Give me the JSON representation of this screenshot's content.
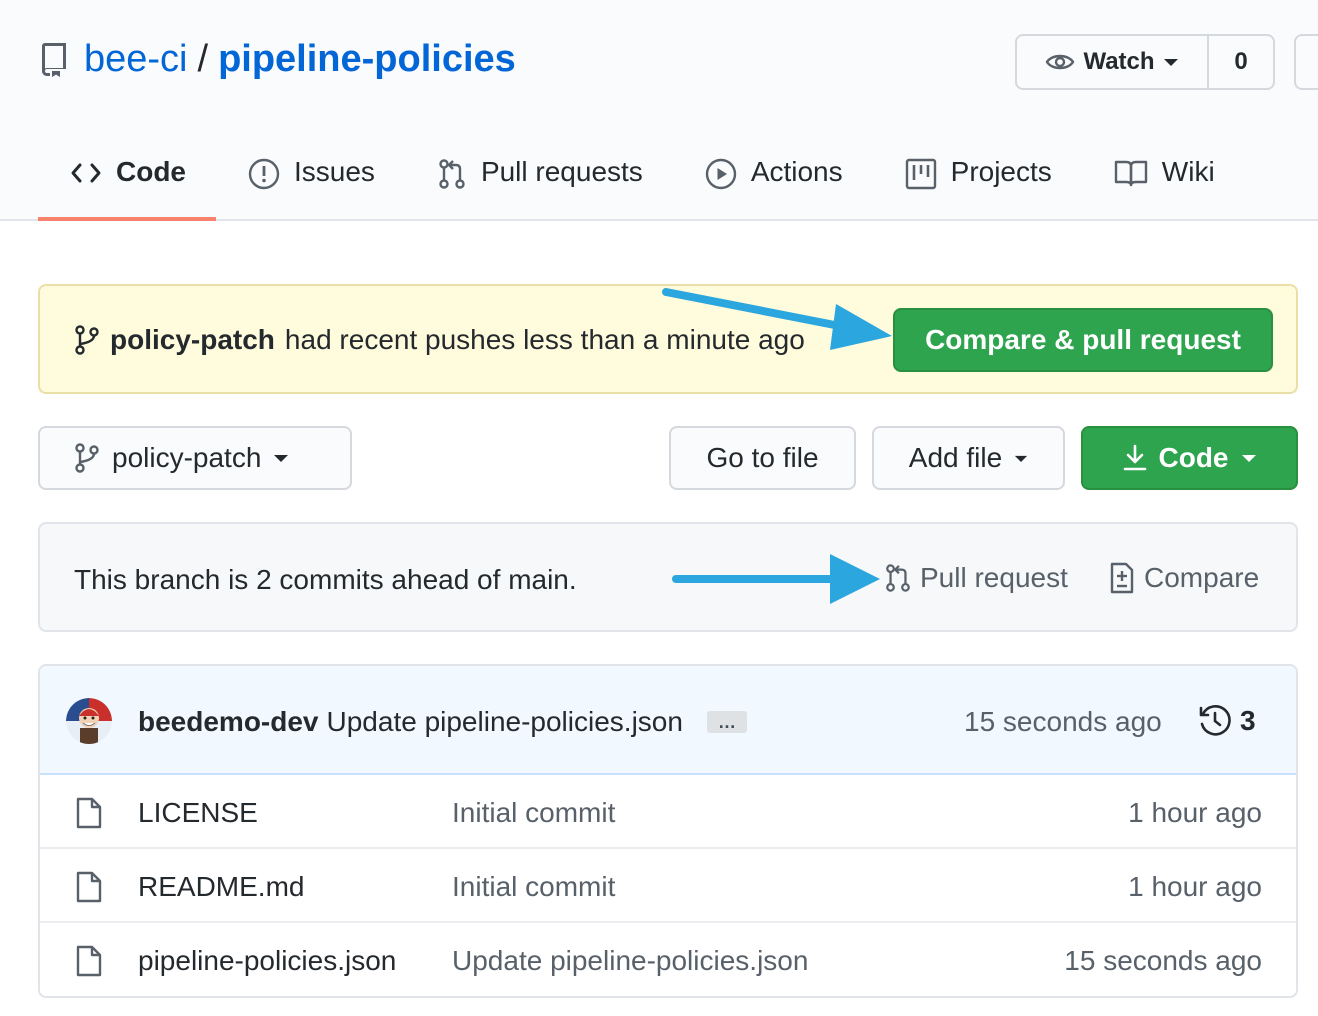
{
  "repo": {
    "owner": "bee-ci",
    "separator": "/",
    "name": "pipeline-policies"
  },
  "watch": {
    "label": "Watch",
    "count": "0"
  },
  "tabs": [
    {
      "label": "Code",
      "icon": "code-icon",
      "selected": true
    },
    {
      "label": "Issues",
      "icon": "issue-icon"
    },
    {
      "label": "Pull requests",
      "icon": "pull-request-icon"
    },
    {
      "label": "Actions",
      "icon": "play-icon"
    },
    {
      "label": "Projects",
      "icon": "project-icon"
    },
    {
      "label": "Wiki",
      "icon": "book-icon"
    }
  ],
  "banner": {
    "branch": "policy-patch",
    "message": "had recent pushes less than a minute ago",
    "button": "Compare & pull request"
  },
  "toolbar": {
    "branch": "policy-patch",
    "go_to_file": "Go to file",
    "add_file": "Add file",
    "code": "Code"
  },
  "ahead": {
    "message": "This branch is 2 commits ahead of main.",
    "pull_request": "Pull request",
    "compare": "Compare"
  },
  "latest_commit": {
    "author": "beedemo-dev",
    "message": "Update pipeline-policies.json",
    "ellipsis": "…",
    "time": "15 seconds ago",
    "commit_count": "3"
  },
  "files": [
    {
      "name": "LICENSE",
      "commit": "Initial commit",
      "time": "1 hour ago"
    },
    {
      "name": "README.md",
      "commit": "Initial commit",
      "time": "1 hour ago"
    },
    {
      "name": "pipeline-policies.json",
      "commit": "Update pipeline-policies.json",
      "time": "15 seconds ago"
    }
  ],
  "colors": {
    "link": "#0366d6",
    "primary_green": "#2ea44f",
    "banner_bg": "#fffbdd",
    "annotation_arrow": "#2ba6de",
    "tab_underline": "#f9826c"
  }
}
